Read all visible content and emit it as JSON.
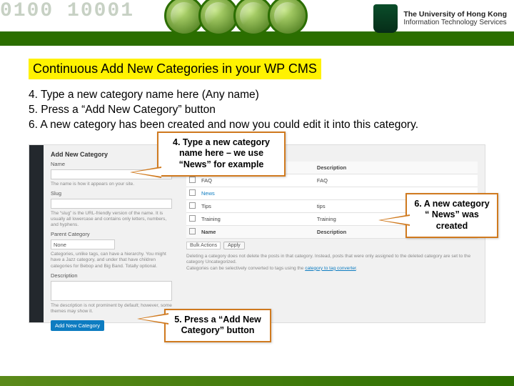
{
  "banner": {
    "digits": "0100    10001",
    "brand_line1": "The University of Hong Kong",
    "brand_line2": "Information Technology Services"
  },
  "title": "Continuous Add New Categories in your WP CMS",
  "steps": {
    "s4": "4. Type a new category name here (Any name)",
    "s5": "5. Press a “Add New Category” button",
    "s6": "6. A new category has been created and now you could edit it into this category."
  },
  "wp": {
    "left_heading": "Add New Category",
    "name_label": "Name",
    "name_help": "The name is how it appears on your site.",
    "slug_label": "Slug",
    "slug_help": "The “slug” is the URL-friendly version of the name. It is usually all lowercase and contains only letters, numbers, and hyphens.",
    "parent_label": "Parent Category",
    "parent_value": "None",
    "parent_help": "Categories, unlike tags, can have a hierarchy. You might have a Jazz category, and under that have children categories for Bebop and Big Band. Totally optional.",
    "desc_label": "Description",
    "desc_help": "The description is not prominent by default; however, some themes may show it.",
    "button": "Add New Category",
    "bulk_actions": "Bulk Actions",
    "apply": "Apply",
    "th_name": "Name",
    "th_desc": "Description",
    "rows1": [
      "FAQ",
      "News",
      "Tips",
      "Training"
    ],
    "slugs1": [
      "FAQ",
      "",
      "tips",
      "Training"
    ],
    "rows2_name": "Name",
    "rows2_desc": "Description",
    "note": "Deleting a category does not delete the posts in that category. Instead, posts that were only assigned to the deleted category are set to the category Uncategorized.",
    "note_link": "category to tag converter"
  },
  "callouts": {
    "c4": "4. Type a new category name here – we use “News” for example",
    "c5": "5. Press a “Add New Category” button",
    "c6": "6. A new category “ News” was created"
  }
}
